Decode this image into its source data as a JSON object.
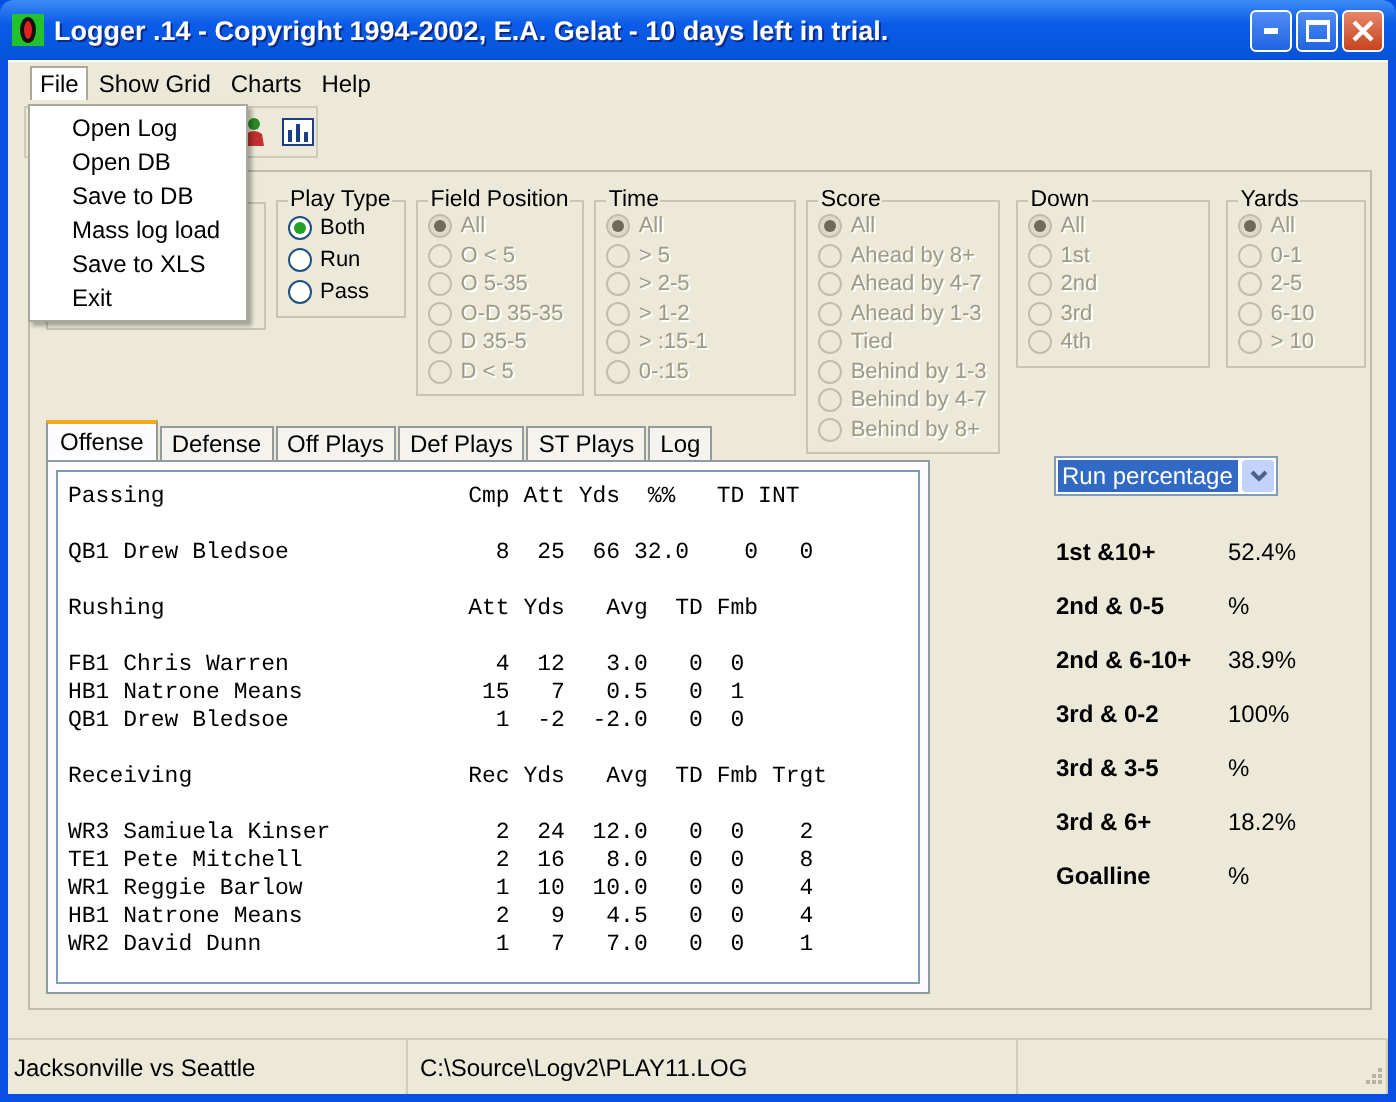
{
  "window": {
    "title": "Logger .14 - Copyright 1994-2002, E.A. Gelat - 10 days left in trial."
  },
  "menu": [
    {
      "label": "File",
      "selected": true
    },
    {
      "label": "Show Grid",
      "selected": false
    },
    {
      "label": "Charts",
      "selected": false
    },
    {
      "label": "Help",
      "selected": false
    }
  ],
  "file_menu": [
    "Open Log",
    "Open DB",
    "Save to DB",
    "Mass log load",
    "Save to XLS",
    "Exit"
  ],
  "filters": [
    {
      "title": "Play Type",
      "disabled": false,
      "options": [
        {
          "label": "Both",
          "selected": true
        },
        {
          "label": "Run",
          "selected": false
        },
        {
          "label": "Pass",
          "selected": false
        }
      ]
    },
    {
      "title": "Field Position",
      "disabled": true,
      "options": [
        {
          "label": "All",
          "selected": true
        },
        {
          "label": "O < 5",
          "selected": false
        },
        {
          "label": "O 5-35",
          "selected": false
        },
        {
          "label": "O-D 35-35",
          "selected": false
        },
        {
          "label": "D 35-5",
          "selected": false
        },
        {
          "label": "D < 5",
          "selected": false
        }
      ]
    },
    {
      "title": "Time",
      "disabled": true,
      "options": [
        {
          "label": "All",
          "selected": true
        },
        {
          "label": "> 5",
          "selected": false
        },
        {
          "label": "> 2-5",
          "selected": false
        },
        {
          "label": "> 1-2",
          "selected": false
        },
        {
          "label": "> :15-1",
          "selected": false
        },
        {
          "label": "0-:15",
          "selected": false
        }
      ]
    },
    {
      "title": "Score",
      "disabled": true,
      "options": [
        {
          "label": "All",
          "selected": true
        },
        {
          "label": "Ahead by 8+",
          "selected": false
        },
        {
          "label": "Ahead by 4-7",
          "selected": false
        },
        {
          "label": "Ahead by 1-3",
          "selected": false
        },
        {
          "label": "Tied",
          "selected": false
        },
        {
          "label": "Behind by 1-3",
          "selected": false
        },
        {
          "label": "Behind by 4-7",
          "selected": false
        },
        {
          "label": "Behind by 8+",
          "selected": false
        }
      ]
    },
    {
      "title": "Down",
      "disabled": true,
      "options": [
        {
          "label": "All",
          "selected": true
        },
        {
          "label": "1st",
          "selected": false
        },
        {
          "label": "2nd",
          "selected": false
        },
        {
          "label": "3rd",
          "selected": false
        },
        {
          "label": "4th",
          "selected": false
        }
      ]
    },
    {
      "title": "Yards",
      "disabled": true,
      "options": [
        {
          "label": "All",
          "selected": true
        },
        {
          "label": "0-1",
          "selected": false
        },
        {
          "label": "2-5",
          "selected": false
        },
        {
          "label": "6-10",
          "selected": false
        },
        {
          "label": "> 10",
          "selected": false
        }
      ]
    }
  ],
  "tabs": [
    {
      "label": "Offense",
      "selected": true
    },
    {
      "label": "Defense",
      "selected": false
    },
    {
      "label": "Off Plays",
      "selected": false
    },
    {
      "label": "Def Plays",
      "selected": false
    },
    {
      "label": "ST Plays",
      "selected": false
    },
    {
      "label": "Log",
      "selected": false
    }
  ],
  "report": [
    {
      "header": "Passing                      Cmp Att Yds  %%   TD INT",
      "rows": [
        "QB1 Drew Bledsoe               8  25  66 32.0    0   0"
      ]
    },
    {
      "header": "Rushing                      Att Yds   Avg  TD Fmb",
      "rows": [
        "FB1 Chris Warren               4  12   3.0   0  0",
        "HB1 Natrone Means             15   7   0.5   0  1",
        "QB1 Drew Bledsoe               1  -2  -2.0   0  0"
      ]
    },
    {
      "header": "Receiving                    Rec Yds   Avg  TD Fmb Trgt",
      "rows": [
        "WR3 Samiuela Kinser            2  24  12.0   0  0    2",
        "TE1 Pete Mitchell              2  16   8.0   0  0    8",
        "WR1 Reggie Barlow              1  10  10.0   0  0    4",
        "HB1 Natrone Means              2   9   4.5   0  0    4",
        "WR2 David Dunn                 1   7   7.0   0  0    1"
      ]
    }
  ],
  "chart_select": {
    "value": "Run percentage"
  },
  "stats": [
    {
      "label": "1st &10+",
      "value": "52.4%"
    },
    {
      "label": "2nd & 0-5",
      "value": "%"
    },
    {
      "label": "2nd & 6-10+",
      "value": "38.9%"
    },
    {
      "label": "3rd & 0-2",
      "value": "100%"
    },
    {
      "label": "3rd & 3-5",
      "value": "%"
    },
    {
      "label": "3rd & 6+",
      "value": "18.2%"
    },
    {
      "label": "Goalline",
      "value": "%"
    }
  ],
  "status_bar": [
    "Jacksonville vs Seattle",
    "C:\\Source\\Logv2\\PLAY11.LOG"
  ]
}
